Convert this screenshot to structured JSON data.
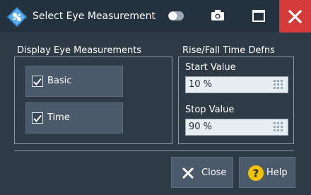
{
  "window": {
    "title": "Select Eye Measurement",
    "icons": {
      "app": "rs-logo-icon",
      "toggle": "toggle-icon",
      "camera": "camera-icon",
      "maximize": "maximize-icon",
      "close": "close-icon"
    }
  },
  "display_group": {
    "title": "Display Eye Measurements",
    "items": [
      {
        "label": "Basic",
        "checked": true
      },
      {
        "label": "Time",
        "checked": true
      }
    ]
  },
  "rise_fall_group": {
    "title": "Rise/Fall Time Defns",
    "start": {
      "label": "Start Value",
      "value": "10 %"
    },
    "stop": {
      "label": "Stop Value",
      "value": "90 %"
    }
  },
  "buttons": {
    "close": {
      "label": "Close",
      "icon": "x-icon"
    },
    "help": {
      "label": "Help",
      "icon": "question-icon"
    }
  },
  "colors": {
    "background": "#2e3a46",
    "titlebar": "#243240",
    "close_red": "#d63b3b",
    "button": "#4a5a6a",
    "help_yellow": "#f2c200",
    "field": "#e8edf1"
  }
}
